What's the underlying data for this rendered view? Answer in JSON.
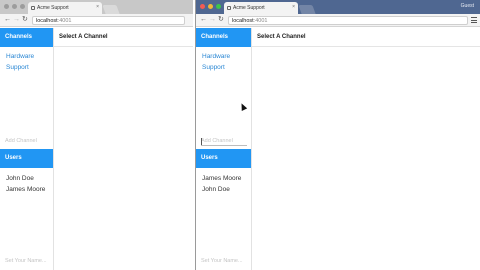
{
  "browser": {
    "tab_title": "Acme Support",
    "tab_close": "×",
    "url_host": "localhost",
    "url_port": ":4001",
    "user_label": "Guest"
  },
  "nav": {
    "back": "←",
    "forward": "→",
    "reload": "↻"
  },
  "sidebar": {
    "channels_heading": "Channels",
    "channels": [
      "Hardware",
      "Support"
    ],
    "add_channel_placeholder": "Add Channel",
    "users_heading": "Users",
    "left_users": [
      "John Doe",
      "James Moore"
    ],
    "right_users": [
      "James Moore",
      "John Doe"
    ],
    "nickname_placeholder": "Set Your Name..."
  },
  "main": {
    "heading": "Select A Channel"
  },
  "colors": {
    "accent": "#2196f3",
    "link": "#2a87d4"
  }
}
